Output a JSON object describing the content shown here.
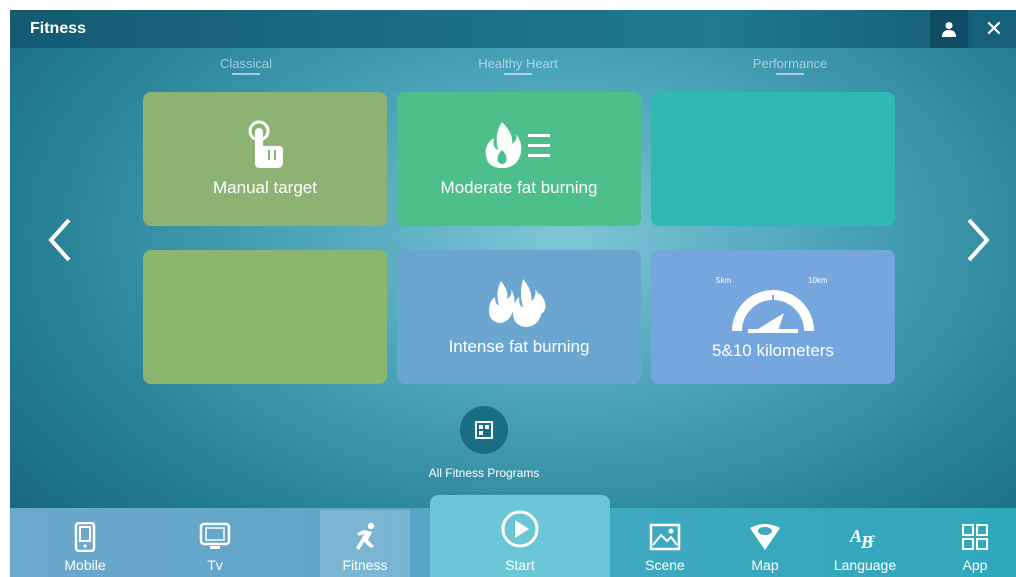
{
  "header": {
    "title": "Fitness"
  },
  "categories": [
    "Classical",
    "Healthy Heart",
    "Performance"
  ],
  "tiles": [
    {
      "label": "Manual target",
      "icon": "hand-pointer-icon",
      "color": "#8db374"
    },
    {
      "label": "Moderate fat burning",
      "icon": "fire-list-icon",
      "color": "#4cbf8a"
    },
    {
      "label": "",
      "icon": "",
      "color": "#2fb9b3"
    },
    {
      "label": "",
      "icon": "",
      "color": "#8cb66e"
    },
    {
      "label": "Intense fat burning",
      "icon": "flames-icon",
      "color": "#6aa6cf"
    },
    {
      "label": "5&10 kilometers",
      "icon": "speedometer-icon",
      "color": "#76a6de",
      "gauge_labels": [
        "5km",
        "10km"
      ]
    }
  ],
  "all_programs": {
    "label": "All Fitness Programs"
  },
  "bottom_nav": [
    {
      "label": "Mobile",
      "icon": "mobile-icon"
    },
    {
      "label": "Tv",
      "icon": "tv-icon"
    },
    {
      "label": "Fitness",
      "icon": "runner-icon",
      "active": true
    },
    {
      "label": "Start",
      "icon": "play-icon"
    },
    {
      "label": "Scene",
      "icon": "image-icon"
    },
    {
      "label": "Map",
      "icon": "map-pin-icon"
    },
    {
      "label": "Language",
      "icon": "language-icon"
    },
    {
      "label": "App",
      "icon": "apps-grid-icon"
    }
  ]
}
